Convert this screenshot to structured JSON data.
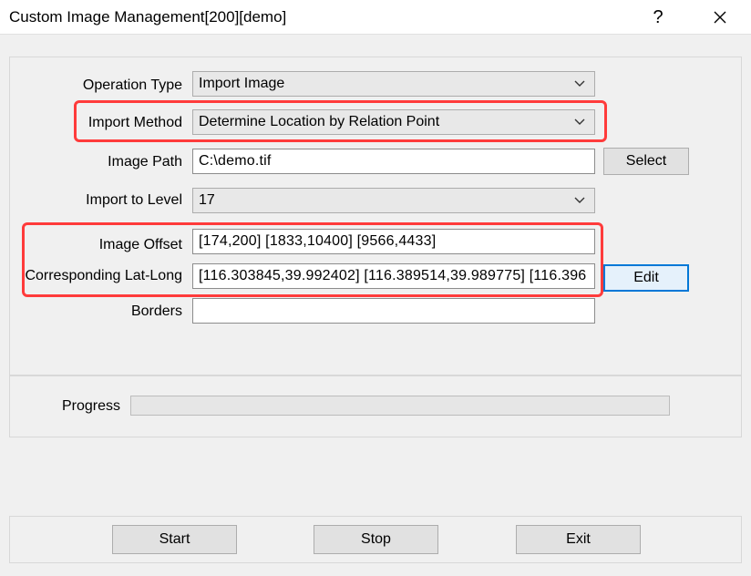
{
  "window": {
    "title": "Custom Image Management[200][demo]",
    "help_glyph": "?",
    "close_icon": "close-icon"
  },
  "form": {
    "operation_type": {
      "label": "Operation Type",
      "value": "Import Image"
    },
    "import_method": {
      "label": "Import Method",
      "value": "Determine Location by Relation Point"
    },
    "image_path": {
      "label": "Image Path",
      "value": "C:\\demo.tif",
      "button": "Select"
    },
    "import_level": {
      "label": "Import to Level",
      "value": "17"
    },
    "image_offset": {
      "label": "Image Offset",
      "value": "[174,200] [1833,10400] [9566,4433]"
    },
    "lat_long": {
      "label": "Corresponding Lat-Long",
      "value": "[116.303845,39.992402] [116.389514,39.989775] [116.396",
      "button": "Edit"
    },
    "borders": {
      "label": "Borders",
      "value": ""
    }
  },
  "progress": {
    "label": "Progress",
    "value": 0
  },
  "actions": {
    "start": "Start",
    "stop": "Stop",
    "exit": "Exit"
  },
  "colors": {
    "highlight": "#ff3b3b",
    "focus": "#0078d7"
  }
}
